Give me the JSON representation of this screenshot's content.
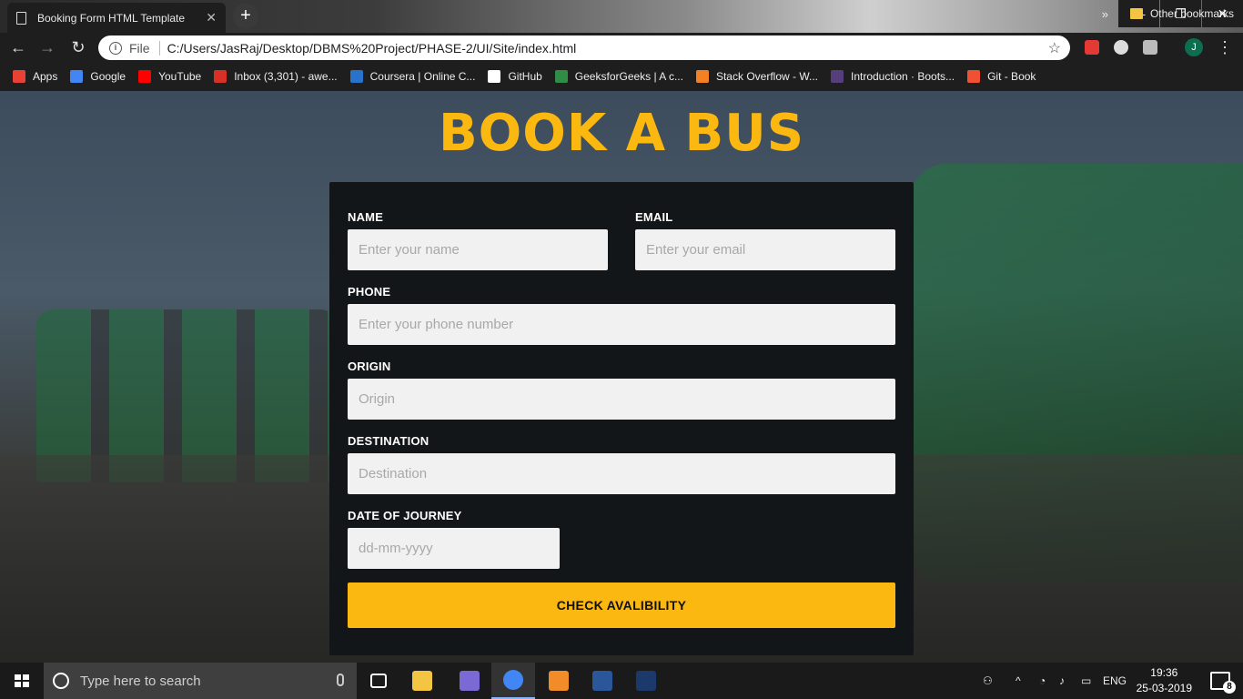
{
  "browser": {
    "tab_title": "Booking Form HTML Template",
    "tab_close": "✕",
    "new_tab": "+",
    "window_controls": {
      "minimize": "—",
      "restore": "❐",
      "close": "✕"
    },
    "address": {
      "scheme_label": "File",
      "url": "C:/Users/JasRaj/Desktop/DBMS%20Project/PHASE-2/UI/Site/index.html"
    },
    "profile_initial": "J",
    "bookmarks": [
      {
        "label": "Apps",
        "color": "#e94235"
      },
      {
        "label": "Google",
        "color": "#4285f4"
      },
      {
        "label": "YouTube",
        "color": "#ff0000"
      },
      {
        "label": "Inbox (3,301) - awe...",
        "color": "#d93025"
      },
      {
        "label": "Coursera | Online C...",
        "color": "#2a73cc"
      },
      {
        "label": "GitHub",
        "color": "#ffffff"
      },
      {
        "label": "GeeksforGeeks | A c...",
        "color": "#2f8d46"
      },
      {
        "label": "Stack Overflow - W...",
        "color": "#f48024"
      },
      {
        "label": "Introduction · Boots...",
        "color": "#563d7c"
      },
      {
        "label": "Git - Book",
        "color": "#f05133"
      }
    ],
    "bookmarks_more": "»",
    "other_bookmarks": "Other bookmarks"
  },
  "page": {
    "heading": "BOOK A BUS",
    "accent_color": "#fbb810",
    "form": {
      "name": {
        "label": "NAME",
        "placeholder": "Enter your name"
      },
      "email": {
        "label": "EMAIL",
        "placeholder": "Enter your email"
      },
      "phone": {
        "label": "PHONE",
        "placeholder": "Enter your phone number"
      },
      "origin": {
        "label": "ORIGIN",
        "placeholder": "Origin"
      },
      "destination": {
        "label": "DESTINATION",
        "placeholder": "Destination"
      },
      "date": {
        "label": "DATE OF JOURNEY",
        "placeholder": "dd-mm-yyyy"
      },
      "submit_label": "CHECK AVALIBILITY"
    }
  },
  "taskbar": {
    "search_placeholder": "Type here to search",
    "apps": [
      {
        "name": "task-view",
        "color": "#ffffff",
        "active": false
      },
      {
        "name": "file-explorer",
        "color": "#f4c542",
        "active": false
      },
      {
        "name": "media-app",
        "color": "#7b6ad6",
        "active": false
      },
      {
        "name": "chrome",
        "color": "#4285f4",
        "active": true
      },
      {
        "name": "sublime-text",
        "color": "#f28c28",
        "active": false
      },
      {
        "name": "word",
        "color": "#2b579a",
        "active": false
      },
      {
        "name": "mysql-terminal",
        "color": "#1b3a6b",
        "active": false
      }
    ],
    "language": "ENG",
    "time": "19:36",
    "date": "25-03-2019",
    "notification_count": "8"
  }
}
